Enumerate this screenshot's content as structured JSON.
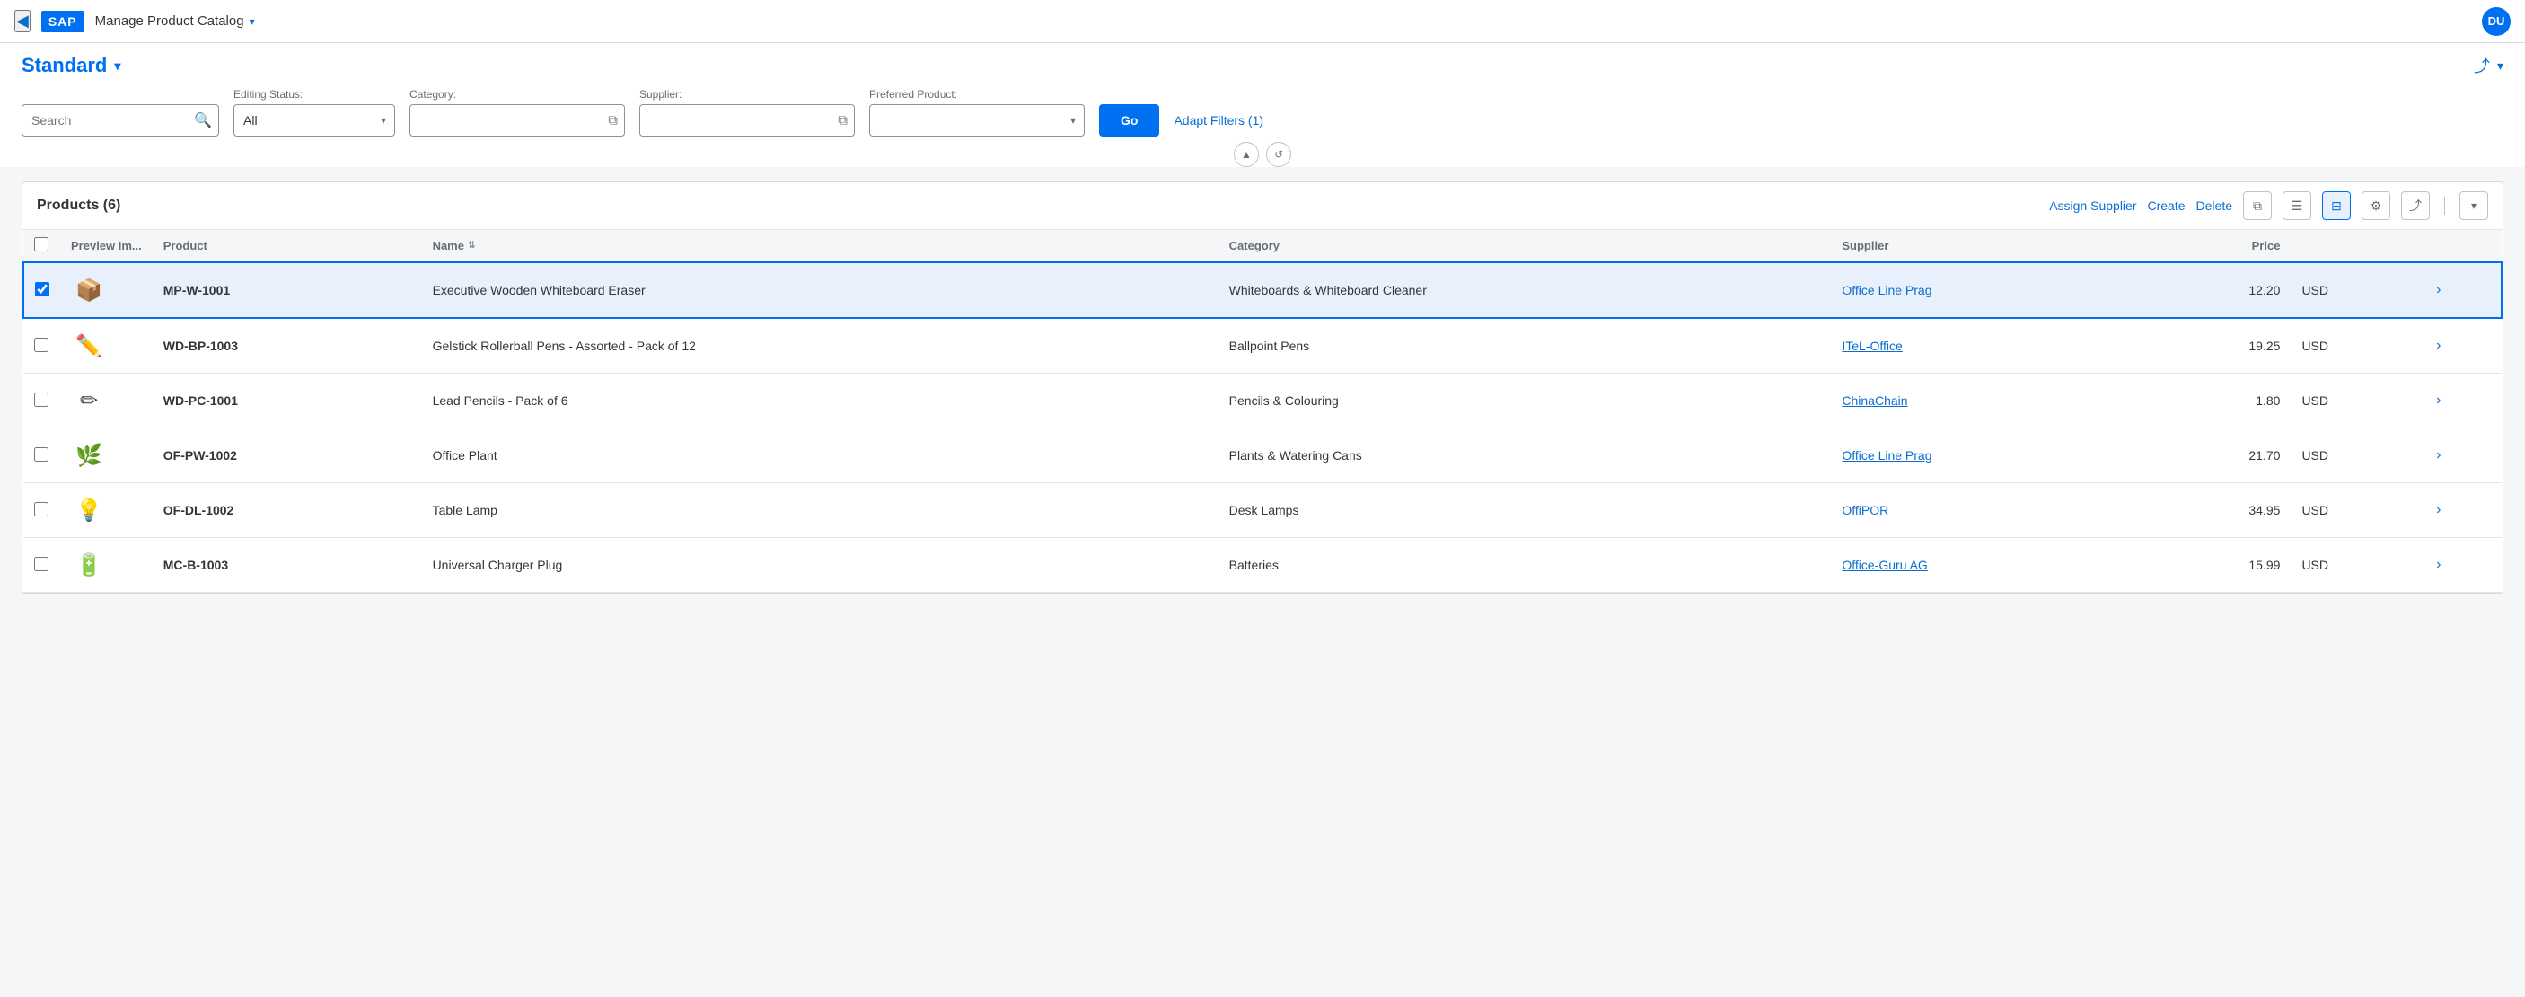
{
  "nav": {
    "back_icon": "◀",
    "title": "Manage Product Catalog",
    "title_chevron": "▾",
    "user_initials": "DU"
  },
  "page": {
    "title": "Standard",
    "title_chevron": "▾",
    "export_icon": "⤴"
  },
  "filters": {
    "search_placeholder": "Search",
    "editing_status_label": "Editing Status:",
    "editing_status_default": "All",
    "category_label": "Category:",
    "supplier_label": "Supplier:",
    "preferred_product_label": "Preferred Product:",
    "go_button": "Go",
    "adapt_filters_button": "Adapt Filters (1)"
  },
  "products": {
    "title": "Products (6)",
    "count": 6,
    "actions": {
      "assign_supplier": "Assign Supplier",
      "create": "Create",
      "delete": "Delete"
    },
    "columns": {
      "preview": "Preview Im...",
      "product": "Product",
      "name": "Name",
      "category": "Category",
      "supplier": "Supplier",
      "price": "Price"
    },
    "rows": [
      {
        "id": 1,
        "selected": true,
        "icon": "🟫",
        "emoji": "📦",
        "product_id": "MP-W-1001",
        "name": "Executive Wooden Whiteboard Eraser",
        "category": "Whiteboards & Whiteboard Cleaner",
        "supplier": "Office Line Prag",
        "price": "12.20",
        "currency": "USD"
      },
      {
        "id": 2,
        "selected": false,
        "emoji": "✏️",
        "product_id": "WD-BP-1003",
        "name": "Gelstick Rollerball Pens - Assorted - Pack of 12",
        "category": "Ballpoint Pens",
        "supplier": "ITeL-Office",
        "price": "19.25",
        "currency": "USD"
      },
      {
        "id": 3,
        "selected": false,
        "emoji": "✏",
        "product_id": "WD-PC-1001",
        "name": "Lead Pencils - Pack of 6",
        "category": "Pencils & Colouring",
        "supplier": "ChinaChain",
        "price": "1.80",
        "currency": "USD"
      },
      {
        "id": 4,
        "selected": false,
        "emoji": "🌿",
        "product_id": "OF-PW-1002",
        "name": "Office Plant",
        "category": "Plants & Watering Cans",
        "supplier": "Office Line Prag",
        "price": "21.70",
        "currency": "USD"
      },
      {
        "id": 5,
        "selected": false,
        "emoji": "💡",
        "product_id": "OF-DL-1002",
        "name": "Table Lamp",
        "category": "Desk Lamps",
        "supplier": "OffiPOR",
        "price": "34.95",
        "currency": "USD"
      },
      {
        "id": 6,
        "selected": false,
        "emoji": "🔋",
        "product_id": "MC-B-1003",
        "name": "Universal Charger Plug",
        "category": "Batteries",
        "supplier": "Office-Guru AG",
        "price": "15.99",
        "currency": "USD"
      }
    ]
  },
  "icons": {
    "search": "🔍",
    "chevron_down": "▾",
    "copy": "⧉",
    "collapse_up": "▲",
    "refresh": "↺",
    "list_view": "☰",
    "grid_view": "⊞",
    "settings": "⚙",
    "export": "⤴",
    "more": "▾",
    "nav_right": "›"
  }
}
